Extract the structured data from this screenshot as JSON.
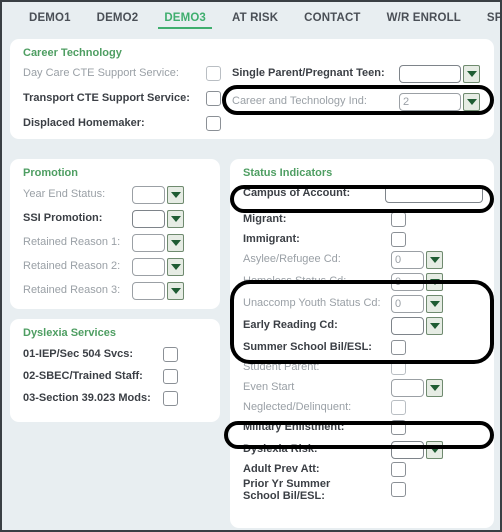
{
  "tabs": [
    {
      "label": "DEMO1",
      "active": false
    },
    {
      "label": "DEMO2",
      "active": false
    },
    {
      "label": "DEMO3",
      "active": true
    },
    {
      "label": "AT RISK",
      "active": false
    },
    {
      "label": "CONTACT",
      "active": false
    },
    {
      "label": "W/R ENROLL",
      "active": false
    },
    {
      "label": "SPE",
      "active": false
    }
  ],
  "colors": {
    "page_bg": "#e8eef1",
    "panel_bg": "#ffffff",
    "accent_green": "#3fae6e",
    "section_title": "#4e9e62",
    "label": "#3b3f45",
    "label_disabled": "#9aa0a6",
    "highlight": "#000000"
  },
  "career_technology": {
    "title": "Career Technology",
    "left_fields": [
      {
        "label": "Day Care CTE Support Service:",
        "type": "checkbox",
        "checked": false,
        "disabled": true
      },
      {
        "label": "Transport CTE Support Service:",
        "type": "checkbox",
        "checked": false,
        "disabled": false
      },
      {
        "label": "Displaced Homemaker:",
        "type": "checkbox",
        "checked": false,
        "disabled": false
      }
    ],
    "right_fields": [
      {
        "label": "Single Parent/Pregnant Teen:",
        "type": "select",
        "value": "",
        "disabled": false
      },
      {
        "label": "Career and Technology Ind:",
        "type": "select",
        "value": "2",
        "disabled": true,
        "highlighted": true
      }
    ]
  },
  "promotion": {
    "title": "Promotion",
    "fields": [
      {
        "label": "Year End Status:",
        "type": "select",
        "value": "",
        "disabled": true
      },
      {
        "label": "SSI Promotion:",
        "type": "select",
        "value": "",
        "disabled": false
      },
      {
        "label": "Retained Reason 1:",
        "type": "select",
        "value": "",
        "disabled": true
      },
      {
        "label": "Retained Reason 2:",
        "type": "select",
        "value": "",
        "disabled": true
      },
      {
        "label": "Retained Reason 3:",
        "type": "select",
        "value": "",
        "disabled": true
      }
    ]
  },
  "dyslexia_services": {
    "title": "Dyslexia Services",
    "fields": [
      {
        "label": "01-IEP/Sec 504 Svcs:",
        "type": "checkbox",
        "checked": false,
        "disabled": false
      },
      {
        "label": "02-SBEC/Trained Staff:",
        "type": "checkbox",
        "checked": false,
        "disabled": false
      },
      {
        "label": "03-Section 39.023 Mods:",
        "type": "checkbox",
        "checked": false,
        "disabled": false
      }
    ]
  },
  "status_indicators": {
    "title": "Status Indicators",
    "fields": [
      {
        "label": "Campus of Account:",
        "type": "text",
        "value": "",
        "disabled": false,
        "highlighted": true
      },
      {
        "label": "Migrant:",
        "type": "checkbox",
        "checked": false,
        "disabled": false
      },
      {
        "label": "Immigrant:",
        "type": "checkbox",
        "checked": false,
        "disabled": false
      },
      {
        "label": "Asylee/Refugee Cd:",
        "type": "select",
        "value": "0",
        "disabled": true
      },
      {
        "label": "Homeless Status Cd:",
        "type": "select",
        "value": "0",
        "disabled": true,
        "highlighted": true
      },
      {
        "label": "Unaccomp Youth Status Cd:",
        "type": "select",
        "value": "0",
        "disabled": true,
        "highlighted": true
      },
      {
        "label": "Early Reading Cd:",
        "type": "select",
        "value": "",
        "disabled": false,
        "highlighted": true
      },
      {
        "label": "Summer School Bil/ESL:",
        "type": "checkbox",
        "checked": false,
        "disabled": false,
        "highlighted": true
      },
      {
        "label": "Student Parent:",
        "type": "checkbox",
        "checked": false,
        "disabled": true
      },
      {
        "label": "Even Start",
        "type": "select",
        "value": "",
        "disabled": true
      },
      {
        "label": "Neglected/Delinquent:",
        "type": "checkbox",
        "checked": false,
        "disabled": true
      },
      {
        "label": "Military Enlistment:",
        "type": "checkbox",
        "checked": false,
        "disabled": false,
        "highlighted": true
      },
      {
        "label": "Dyslexia Risk:",
        "type": "select",
        "value": "",
        "disabled": false
      },
      {
        "label": "Adult Prev Att:",
        "type": "checkbox",
        "checked": false,
        "disabled": false
      },
      {
        "label": "Prior Yr Summer School Bil/ESL:",
        "type": "checkbox",
        "checked": false,
        "disabled": false
      }
    ]
  }
}
